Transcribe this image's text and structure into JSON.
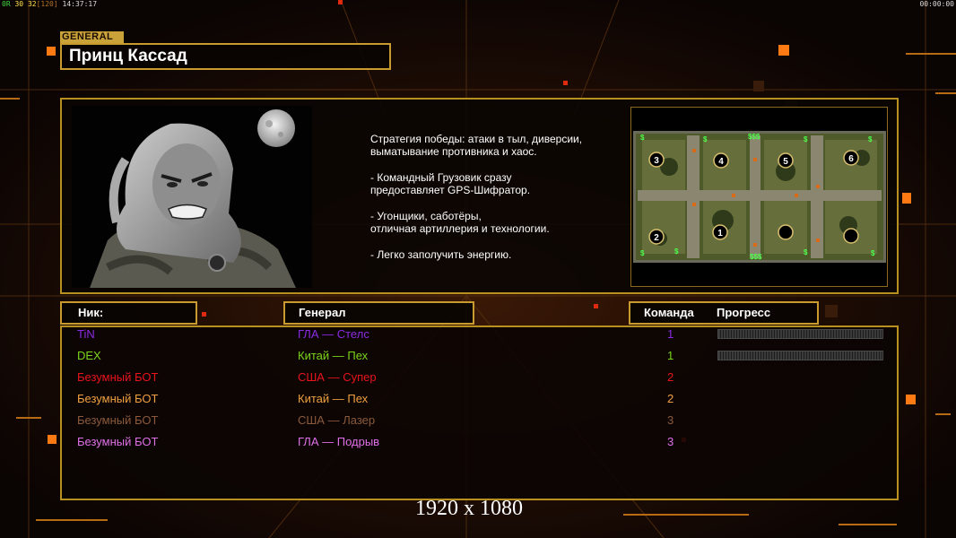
{
  "status_bar": {
    "left_a": "0R",
    "left_b": "30",
    "left_c": "32",
    "left_d": "[120]",
    "time": "14:37:17",
    "right_time": "00:00:00"
  },
  "general": {
    "tag": "GENERAL",
    "name": "Принц Кассад"
  },
  "description": [
    "Стратегия победы: атаки в тыл, диверсии,\n выматывание противника и хаос.",
    "- Командный Грузовик сразу\nпредоставляет GPS-Шифратор.",
    "- Угонщики, саботёры,\nотличная артиллерия и технологии.",
    "- Легко заполучить энергию."
  ],
  "columns": {
    "nick": "Ник:",
    "general": "Генерал",
    "team": "Команда",
    "progress": "Прогресс"
  },
  "players": [
    {
      "nick": "TiN",
      "general": "ГЛА — Стелс",
      "team": "1",
      "color": "#8a2be2",
      "progress_bar": true
    },
    {
      "nick": "DEX",
      "general": "Китай — Пех",
      "team": "1",
      "color": "#7cd31a",
      "progress_bar": true
    },
    {
      "nick": "Безумный БОТ",
      "general": "США — Супер",
      "team": "2",
      "color": "#e8141c",
      "progress_bar": false
    },
    {
      "nick": "Безумный БОТ",
      "general": "Китай — Пех",
      "team": "2",
      "color": "#f0a040",
      "progress_bar": false
    },
    {
      "nick": "Безумный БОТ",
      "general": "США — Лазер",
      "team": "3",
      "color": "#8b5a3c",
      "progress_bar": false
    },
    {
      "nick": "Безумный БОТ",
      "general": "ГЛА — Подрыв",
      "team": "3",
      "color": "#e070e8",
      "progress_bar": false
    }
  ],
  "minimap": {
    "start_positions": [
      "3",
      "4",
      "5",
      "6",
      "2",
      "1"
    ],
    "money_label": "$$$",
    "money_small": "$"
  },
  "resolution": "1920 x 1080",
  "colors": {
    "frame": "#c99a2e",
    "accent_orange": "#ff7a12",
    "tag_bg": "#c9a23a"
  }
}
